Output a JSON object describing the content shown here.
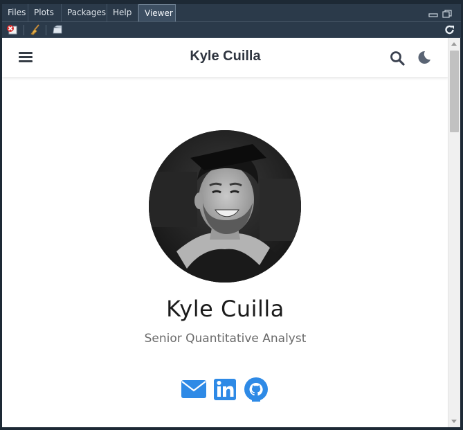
{
  "ide": {
    "tabs": [
      {
        "label": "Files",
        "active": false
      },
      {
        "label": "Plots",
        "active": false
      },
      {
        "label": "Packages",
        "active": false
      },
      {
        "label": "Help",
        "active": false
      },
      {
        "label": "Viewer",
        "active": true
      }
    ],
    "toolbar_icons": [
      "remove-viewer-icon",
      "broom-clear-icon",
      "export-icon",
      "refresh-icon"
    ],
    "window_icons": [
      "minimize-icon",
      "maximize-icon"
    ]
  },
  "page": {
    "site_title": "Kyle Cuilla",
    "profile_name": "Kyle Cuilla",
    "profile_role": "Senior Quantitative Analyst",
    "nav_icons": [
      "menu-icon",
      "search-icon",
      "dark-mode-moon-icon"
    ],
    "social_links": [
      {
        "icon": "email-icon",
        "color": "#2e8ae6"
      },
      {
        "icon": "linkedin-icon",
        "color": "#2e8ae6"
      },
      {
        "icon": "github-icon",
        "color": "#2e8ae6"
      }
    ]
  },
  "colors": {
    "ide_background": "#1d2935",
    "accent_blue": "#2e8ae6",
    "title_text": "#2f3540"
  }
}
